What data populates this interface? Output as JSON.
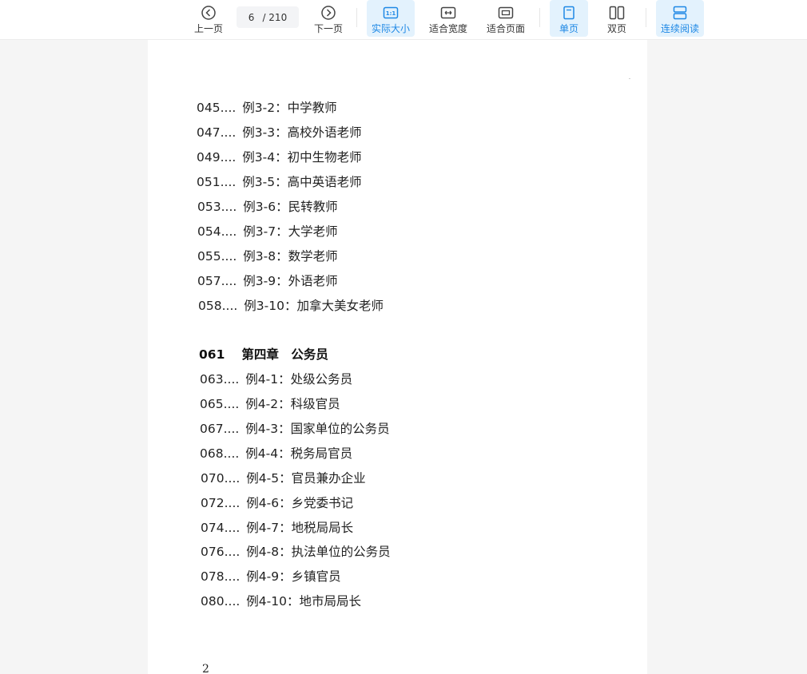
{
  "toolbar": {
    "prev_label": "上一页",
    "current_page": "6",
    "total_pages": "/ 210",
    "next_label": "下一页",
    "actual_size_label": "实际大小",
    "fit_width_label": "适合宽度",
    "fit_page_label": "适合页面",
    "single_page_label": "单页",
    "double_page_label": "双页",
    "continuous_label": "连续阅读",
    "accent_color": "#1e88e5"
  },
  "document": {
    "section3_items": [
      {
        "num": "045....",
        "text": "例3-2：中学教师"
      },
      {
        "num": "047....",
        "text": "例3-3：高校外语老师"
      },
      {
        "num": "049....",
        "text": "例3-4：初中生物老师"
      },
      {
        "num": "051....",
        "text": "例3-5：高中英语老师"
      },
      {
        "num": "053....",
        "text": "例3-6：民转教师"
      },
      {
        "num": "054....",
        "text": "例3-7：大学老师"
      },
      {
        "num": "055....",
        "text": "例3-8：数学老师"
      },
      {
        "num": "057....",
        "text": "例3-9：外语老师"
      },
      {
        "num": "058....",
        "text": "例3-10：加拿大美女老师"
      }
    ],
    "chapter4": {
      "num": "061",
      "title": "第四章　公务员"
    },
    "section4_items": [
      {
        "num": "063....",
        "text": "例4-1：处级公务员"
      },
      {
        "num": "065....",
        "text": "例4-2：科级官员"
      },
      {
        "num": "067....",
        "text": "例4-3：国家单位的公务员"
      },
      {
        "num": "068....",
        "text": "例4-4：税务局官员"
      },
      {
        "num": "070....",
        "text": "例4-5：官员兼办企业"
      },
      {
        "num": "072....",
        "text": "例4-6：乡党委书记"
      },
      {
        "num": "074....",
        "text": "例4-7：地税局局长"
      },
      {
        "num": "076....",
        "text": "例4-8：执法单位的公务员"
      },
      {
        "num": "078....",
        "text": "例4-9：乡镇官员"
      },
      {
        "num": "080....",
        "text": "例4-10：地市局局长"
      }
    ],
    "page_number": "2"
  }
}
